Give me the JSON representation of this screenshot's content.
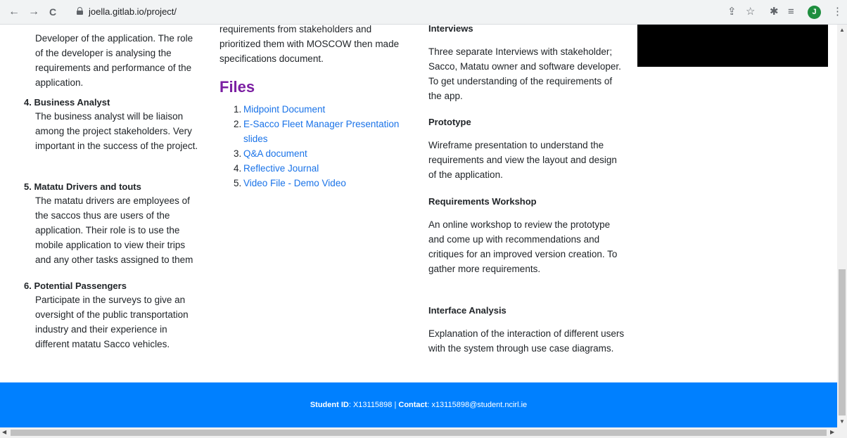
{
  "browser": {
    "back_icon": "←",
    "forward_icon": "→",
    "reload_icon": "C",
    "url": "joella.gitlab.io/project/",
    "avatar_letter": "J"
  },
  "col1": {
    "intro_text": "Developer of the application. The role of the developer is analysing the requirements and performance of the application.",
    "roles": [
      {
        "title": "4. Business Analyst",
        "text": "The business analyst will be liaison among the project stakeholders. Very important in the success of the project."
      },
      {
        "title": "5. Matatu Drivers and touts",
        "text": "The matatu drivers are employees of the saccos thus are users of the application. Their role is to use the mobile application to view their trips and any other tasks assigned to them"
      },
      {
        "title": "6. Potential Passengers",
        "text": "Participate in the surveys to give an oversight of the public transportation industry and their experience in different matatu Sacco vehicles."
      }
    ]
  },
  "col2": {
    "intro_text": "requirements from stakeholders and prioritized them with MOSCOW then made specifications document.",
    "files_heading": "Files",
    "files": [
      {
        "num": "1.",
        "label": "Midpoint Document"
      },
      {
        "num": "2.",
        "label": "E-Sacco Fleet Manager Presentation slides"
      },
      {
        "num": "3.",
        "label": "Q&A document"
      },
      {
        "num": "4.",
        "label": "Reflective Journal"
      },
      {
        "num": "5.",
        "label": "Video File - Demo Video"
      }
    ]
  },
  "col3": {
    "sections": [
      {
        "heading": "Interviews",
        "text": "Three separate Interviews with stakeholder; Sacco, Matatu owner and software developer. To get understanding of the requirements of the app."
      },
      {
        "heading": "Prototype",
        "text": "Wireframe presentation to understand the requirements and view the layout and design of the application."
      },
      {
        "heading": "Requirements Workshop",
        "text": "An online workshop to review the prototype and come up with recommendations and critiques for an improved version creation. To gather more requirements."
      },
      {
        "heading": "Interface Analysis",
        "text": "Explanation of the interaction of different users with the system through use case diagrams."
      }
    ]
  },
  "footer": {
    "student_label": "Student ID",
    "student_value": ": X13115898 | ",
    "contact_label": "Contact",
    "contact_value": ": x13115898@student.ncirl.ie"
  },
  "colors": {
    "footer_bg": "#0080ff",
    "files_heading": "#7b1fa2",
    "link": "#1a73e8"
  }
}
